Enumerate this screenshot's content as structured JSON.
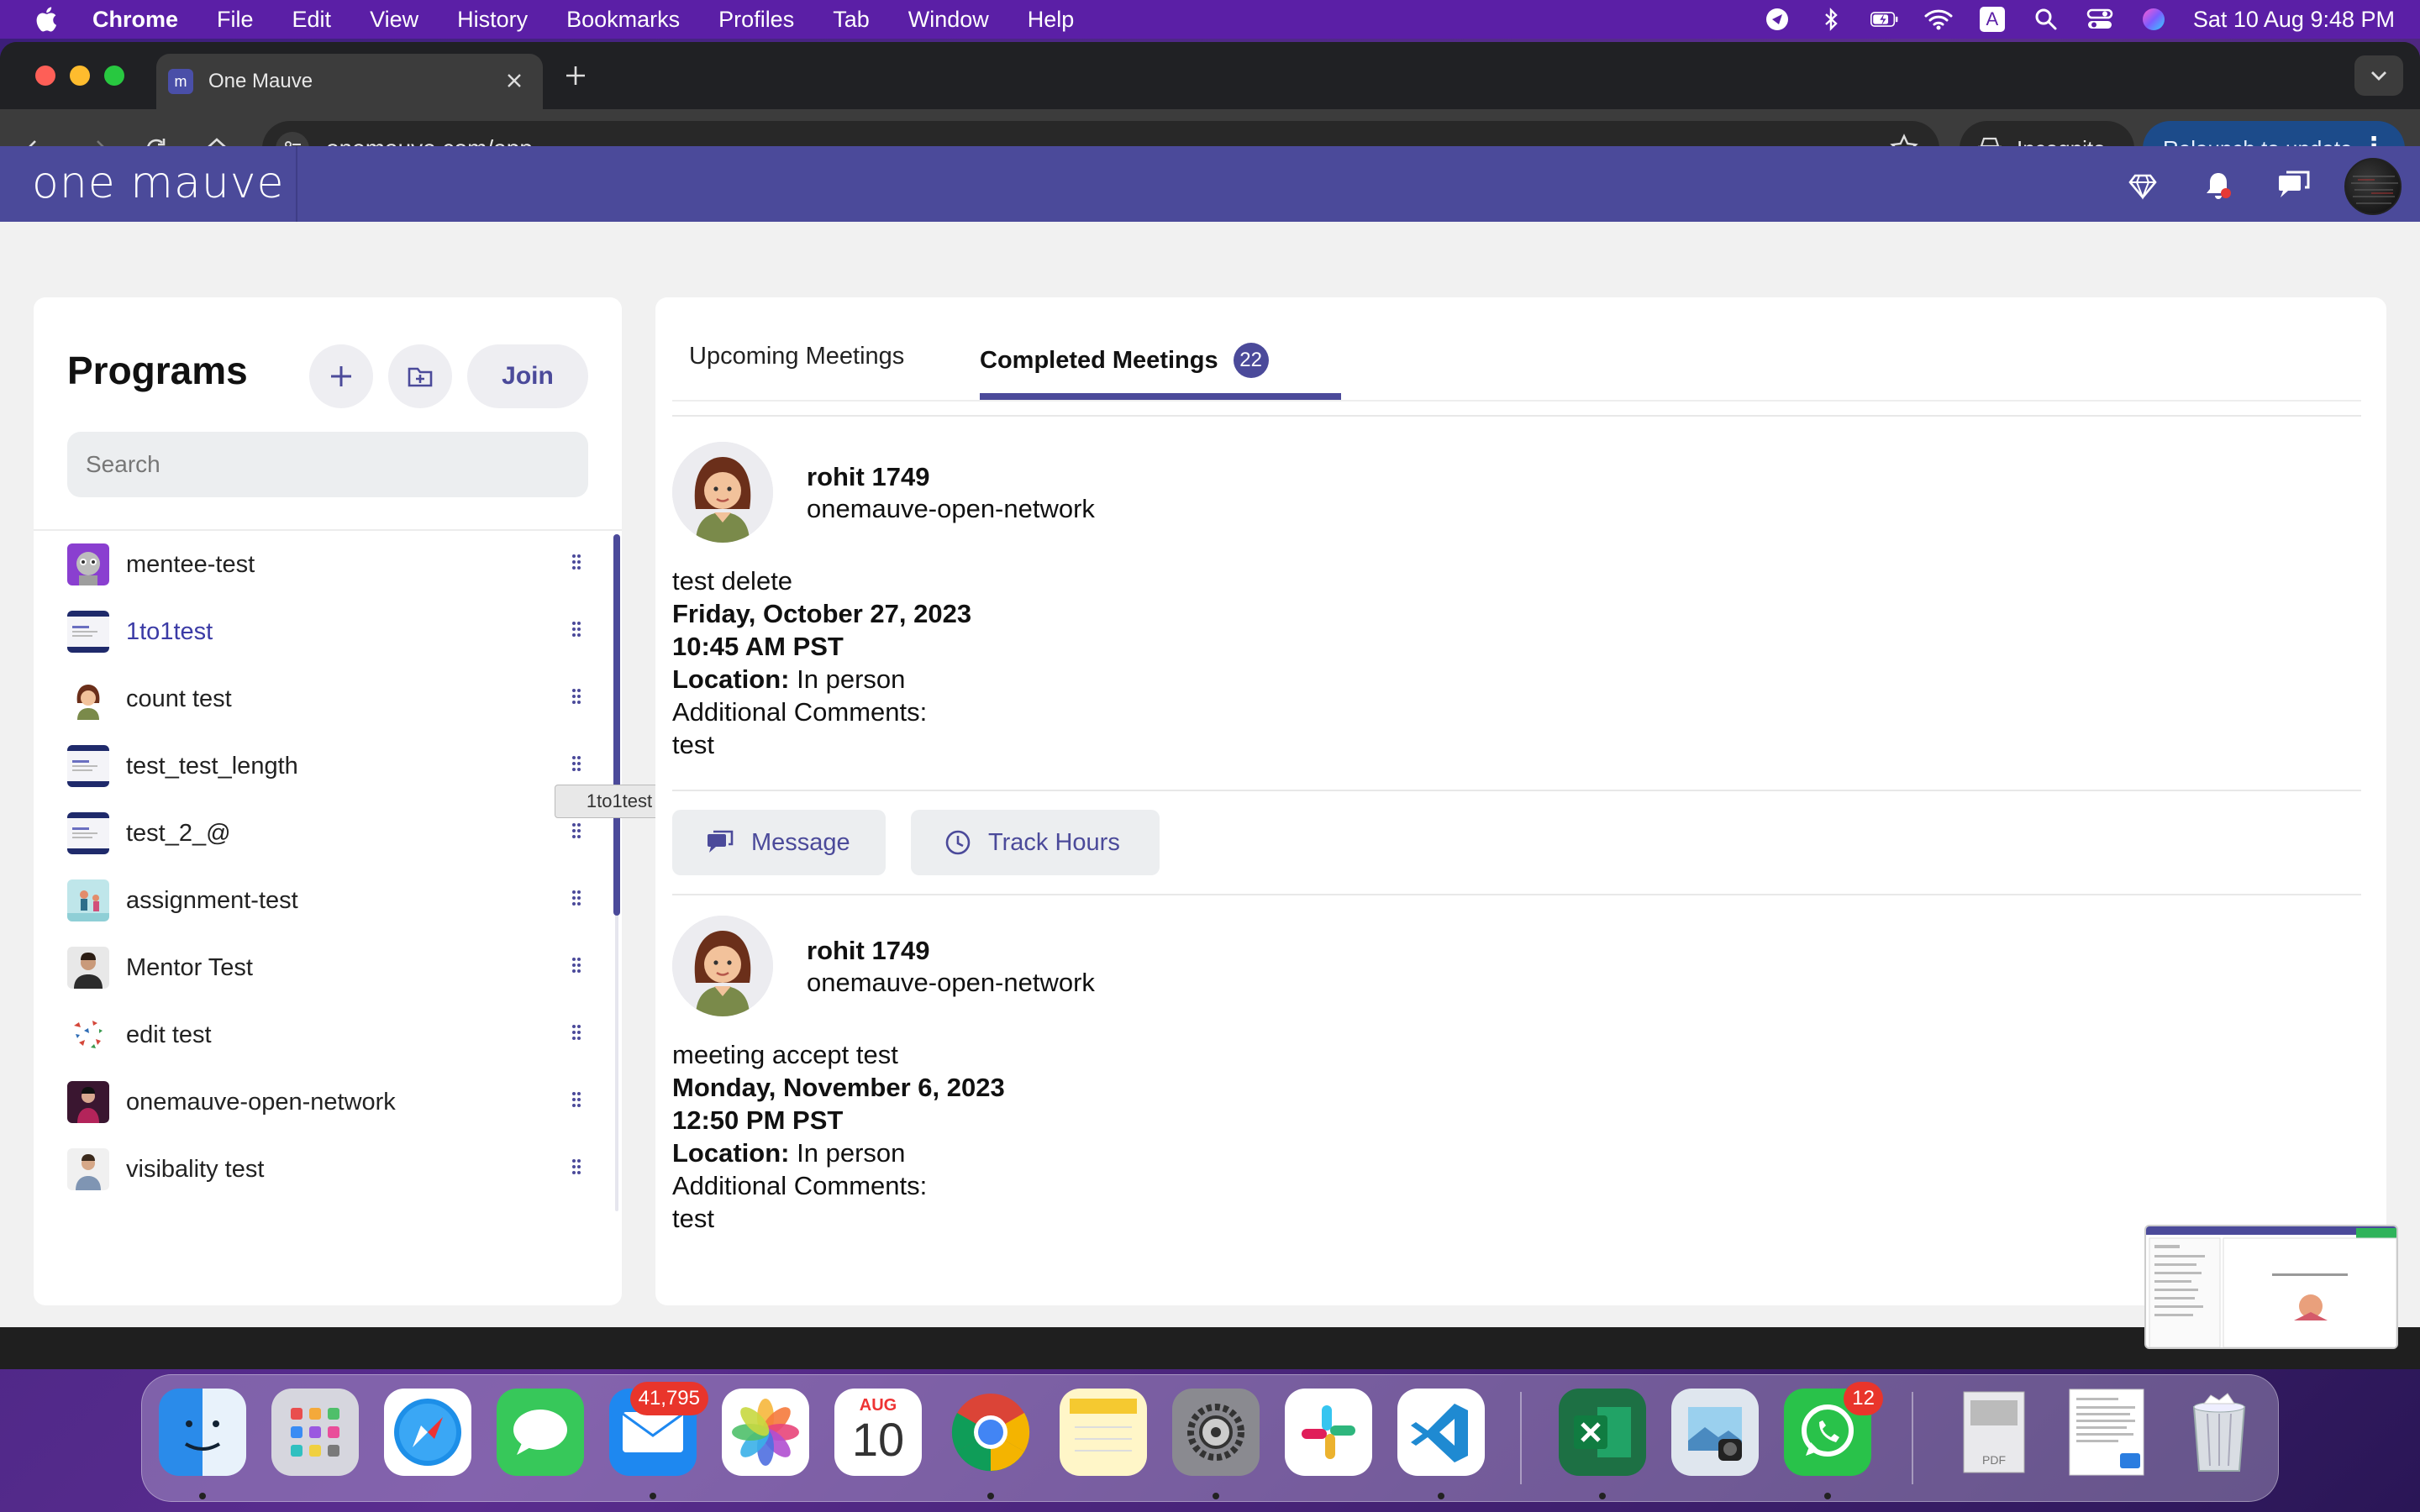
{
  "menubar": {
    "app_name": "Chrome",
    "items": [
      "File",
      "Edit",
      "View",
      "History",
      "Bookmarks",
      "Profiles",
      "Tab",
      "Window",
      "Help"
    ],
    "datetime": "Sat 10 Aug  9:48 PM",
    "input_source": "A"
  },
  "browser": {
    "tab_title": "One Mauve",
    "tab_favicon": "m",
    "url": "onemauve.com/app",
    "incognito_label": "Incognito",
    "relaunch_label": "Relaunch to update"
  },
  "app": {
    "logo": "one mauve",
    "accent_color": "#4b4a9a"
  },
  "programs": {
    "title": "Programs",
    "join_label": "Join",
    "search_placeholder": "Search",
    "items": [
      {
        "name": "mentee-test",
        "thumb": "robot-avatar"
      },
      {
        "name": "1to1test",
        "thumb": "banner"
      },
      {
        "name": "count test",
        "thumb": "woman-avatar"
      },
      {
        "name": "test_test_length",
        "thumb": "banner"
      },
      {
        "name": "test_2_@",
        "thumb": "banner"
      },
      {
        "name": "assignment-test",
        "thumb": "illustration"
      },
      {
        "name": "Mentor Test",
        "thumb": "man-photo"
      },
      {
        "name": "edit test",
        "thumb": "birds"
      },
      {
        "name": "onemauve-open-network",
        "thumb": "person-photo"
      },
      {
        "name": "visibality test",
        "thumb": "man-photo"
      }
    ],
    "tooltip": "1to1test"
  },
  "meetings": {
    "tab_upcoming": "Upcoming Meetings",
    "tab_completed": "Completed Meetings",
    "completed_count": "22",
    "list": [
      {
        "name": "rohit 1749",
        "network": "onemauve-open-network",
        "title": "test delete",
        "date": "Friday, October 27, 2023",
        "time": "10:45 AM PST",
        "location_label": "Location:",
        "location": "In person",
        "comments_label": "Additional Comments:",
        "comments": "test"
      },
      {
        "name": "rohit 1749",
        "network": "onemauve-open-network",
        "title": "meeting accept test",
        "date": "Monday, November 6, 2023",
        "time": "12:50 PM PST",
        "location_label": "Location:",
        "location": "In person",
        "comments_label": "Additional Comments:",
        "comments": "test"
      }
    ],
    "message_label": "Message",
    "track_hours_label": "Track Hours"
  },
  "dock": {
    "mail_badge": "41,795",
    "whatsapp_badge": "12",
    "calendar_month": "AUG",
    "calendar_day": "10"
  }
}
